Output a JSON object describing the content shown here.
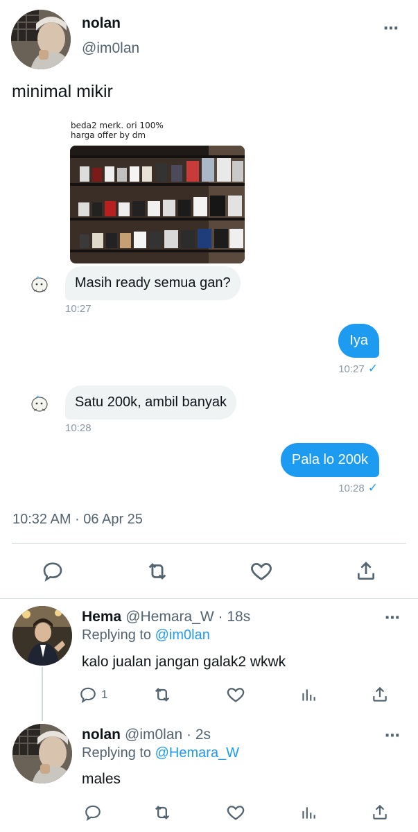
{
  "main_tweet": {
    "name": "nolan",
    "handle": "@im0lan",
    "text": "minimal mikir",
    "image_caption": "beda2 merk. ori 100%\nharga offer by dm",
    "timestamp": "10:32 AM · 06 Apr 25"
  },
  "chat": [
    {
      "direction": "in",
      "text": "Masih ready semua gan?",
      "time": "10:27"
    },
    {
      "direction": "out",
      "text": "Iya",
      "time": "10:27"
    },
    {
      "direction": "in",
      "text": "Satu 200k, ambil banyak",
      "time": "10:28"
    },
    {
      "direction": "out",
      "text": "Pala lo 200k",
      "time": "10:28"
    }
  ],
  "replies": [
    {
      "name": "Hema",
      "handle_time": "@Hemara_W · 18s",
      "replying_prefix": "Replying to ",
      "replying_to": "@im0lan",
      "text": "kalo jualan jangan galak2 wkwk",
      "reply_count": "1"
    },
    {
      "name": "nolan",
      "handle_time": "@im0lan · 2s",
      "replying_prefix": "Replying to ",
      "replying_to": "@Hemara_W",
      "text": "males",
      "reply_count": ""
    }
  ],
  "icons": {
    "more": "⋯"
  },
  "colors": {
    "accent": "#1d9bf0",
    "secondary_text": "#536471",
    "bubble_in": "#eff3f4"
  }
}
